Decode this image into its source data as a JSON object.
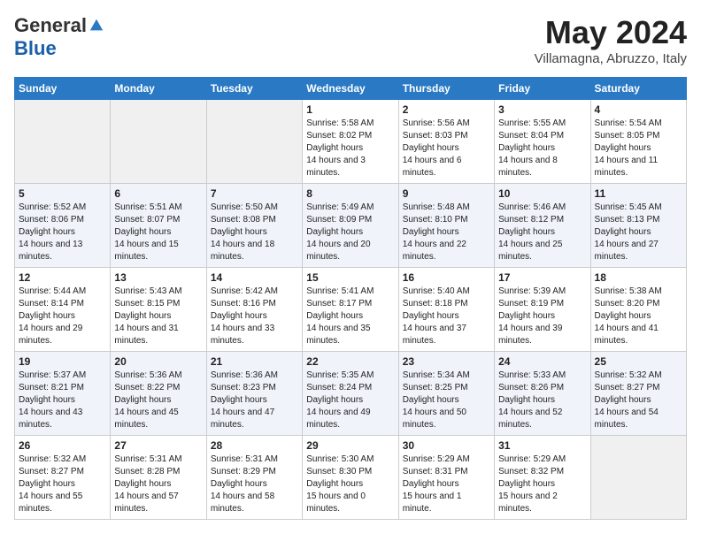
{
  "header": {
    "logo_general": "General",
    "logo_blue": "Blue",
    "month_title": "May 2024",
    "location": "Villamagna, Abruzzo, Italy"
  },
  "days_of_week": [
    "Sunday",
    "Monday",
    "Tuesday",
    "Wednesday",
    "Thursday",
    "Friday",
    "Saturday"
  ],
  "weeks": [
    [
      {
        "day": "",
        "empty": true
      },
      {
        "day": "",
        "empty": true
      },
      {
        "day": "",
        "empty": true
      },
      {
        "day": "1",
        "sunrise": "5:58 AM",
        "sunset": "8:02 PM",
        "daylight": "14 hours and 3 minutes."
      },
      {
        "day": "2",
        "sunrise": "5:56 AM",
        "sunset": "8:03 PM",
        "daylight": "14 hours and 6 minutes."
      },
      {
        "day": "3",
        "sunrise": "5:55 AM",
        "sunset": "8:04 PM",
        "daylight": "14 hours and 8 minutes."
      },
      {
        "day": "4",
        "sunrise": "5:54 AM",
        "sunset": "8:05 PM",
        "daylight": "14 hours and 11 minutes."
      }
    ],
    [
      {
        "day": "5",
        "sunrise": "5:52 AM",
        "sunset": "8:06 PM",
        "daylight": "14 hours and 13 minutes."
      },
      {
        "day": "6",
        "sunrise": "5:51 AM",
        "sunset": "8:07 PM",
        "daylight": "14 hours and 15 minutes."
      },
      {
        "day": "7",
        "sunrise": "5:50 AM",
        "sunset": "8:08 PM",
        "daylight": "14 hours and 18 minutes."
      },
      {
        "day": "8",
        "sunrise": "5:49 AM",
        "sunset": "8:09 PM",
        "daylight": "14 hours and 20 minutes."
      },
      {
        "day": "9",
        "sunrise": "5:48 AM",
        "sunset": "8:10 PM",
        "daylight": "14 hours and 22 minutes."
      },
      {
        "day": "10",
        "sunrise": "5:46 AM",
        "sunset": "8:12 PM",
        "daylight": "14 hours and 25 minutes."
      },
      {
        "day": "11",
        "sunrise": "5:45 AM",
        "sunset": "8:13 PM",
        "daylight": "14 hours and 27 minutes."
      }
    ],
    [
      {
        "day": "12",
        "sunrise": "5:44 AM",
        "sunset": "8:14 PM",
        "daylight": "14 hours and 29 minutes."
      },
      {
        "day": "13",
        "sunrise": "5:43 AM",
        "sunset": "8:15 PM",
        "daylight": "14 hours and 31 minutes."
      },
      {
        "day": "14",
        "sunrise": "5:42 AM",
        "sunset": "8:16 PM",
        "daylight": "14 hours and 33 minutes."
      },
      {
        "day": "15",
        "sunrise": "5:41 AM",
        "sunset": "8:17 PM",
        "daylight": "14 hours and 35 minutes."
      },
      {
        "day": "16",
        "sunrise": "5:40 AM",
        "sunset": "8:18 PM",
        "daylight": "14 hours and 37 minutes."
      },
      {
        "day": "17",
        "sunrise": "5:39 AM",
        "sunset": "8:19 PM",
        "daylight": "14 hours and 39 minutes."
      },
      {
        "day": "18",
        "sunrise": "5:38 AM",
        "sunset": "8:20 PM",
        "daylight": "14 hours and 41 minutes."
      }
    ],
    [
      {
        "day": "19",
        "sunrise": "5:37 AM",
        "sunset": "8:21 PM",
        "daylight": "14 hours and 43 minutes."
      },
      {
        "day": "20",
        "sunrise": "5:36 AM",
        "sunset": "8:22 PM",
        "daylight": "14 hours and 45 minutes."
      },
      {
        "day": "21",
        "sunrise": "5:36 AM",
        "sunset": "8:23 PM",
        "daylight": "14 hours and 47 minutes."
      },
      {
        "day": "22",
        "sunrise": "5:35 AM",
        "sunset": "8:24 PM",
        "daylight": "14 hours and 49 minutes."
      },
      {
        "day": "23",
        "sunrise": "5:34 AM",
        "sunset": "8:25 PM",
        "daylight": "14 hours and 50 minutes."
      },
      {
        "day": "24",
        "sunrise": "5:33 AM",
        "sunset": "8:26 PM",
        "daylight": "14 hours and 52 minutes."
      },
      {
        "day": "25",
        "sunrise": "5:32 AM",
        "sunset": "8:27 PM",
        "daylight": "14 hours and 54 minutes."
      }
    ],
    [
      {
        "day": "26",
        "sunrise": "5:32 AM",
        "sunset": "8:27 PM",
        "daylight": "14 hours and 55 minutes."
      },
      {
        "day": "27",
        "sunrise": "5:31 AM",
        "sunset": "8:28 PM",
        "daylight": "14 hours and 57 minutes."
      },
      {
        "day": "28",
        "sunrise": "5:31 AM",
        "sunset": "8:29 PM",
        "daylight": "14 hours and 58 minutes."
      },
      {
        "day": "29",
        "sunrise": "5:30 AM",
        "sunset": "8:30 PM",
        "daylight": "15 hours and 0 minutes."
      },
      {
        "day": "30",
        "sunrise": "5:29 AM",
        "sunset": "8:31 PM",
        "daylight": "15 hours and 1 minute."
      },
      {
        "day": "31",
        "sunrise": "5:29 AM",
        "sunset": "8:32 PM",
        "daylight": "15 hours and 2 minutes."
      },
      {
        "day": "",
        "empty": true
      }
    ]
  ],
  "labels": {
    "sunrise": "Sunrise:",
    "sunset": "Sunset:",
    "daylight": "Daylight hours"
  }
}
